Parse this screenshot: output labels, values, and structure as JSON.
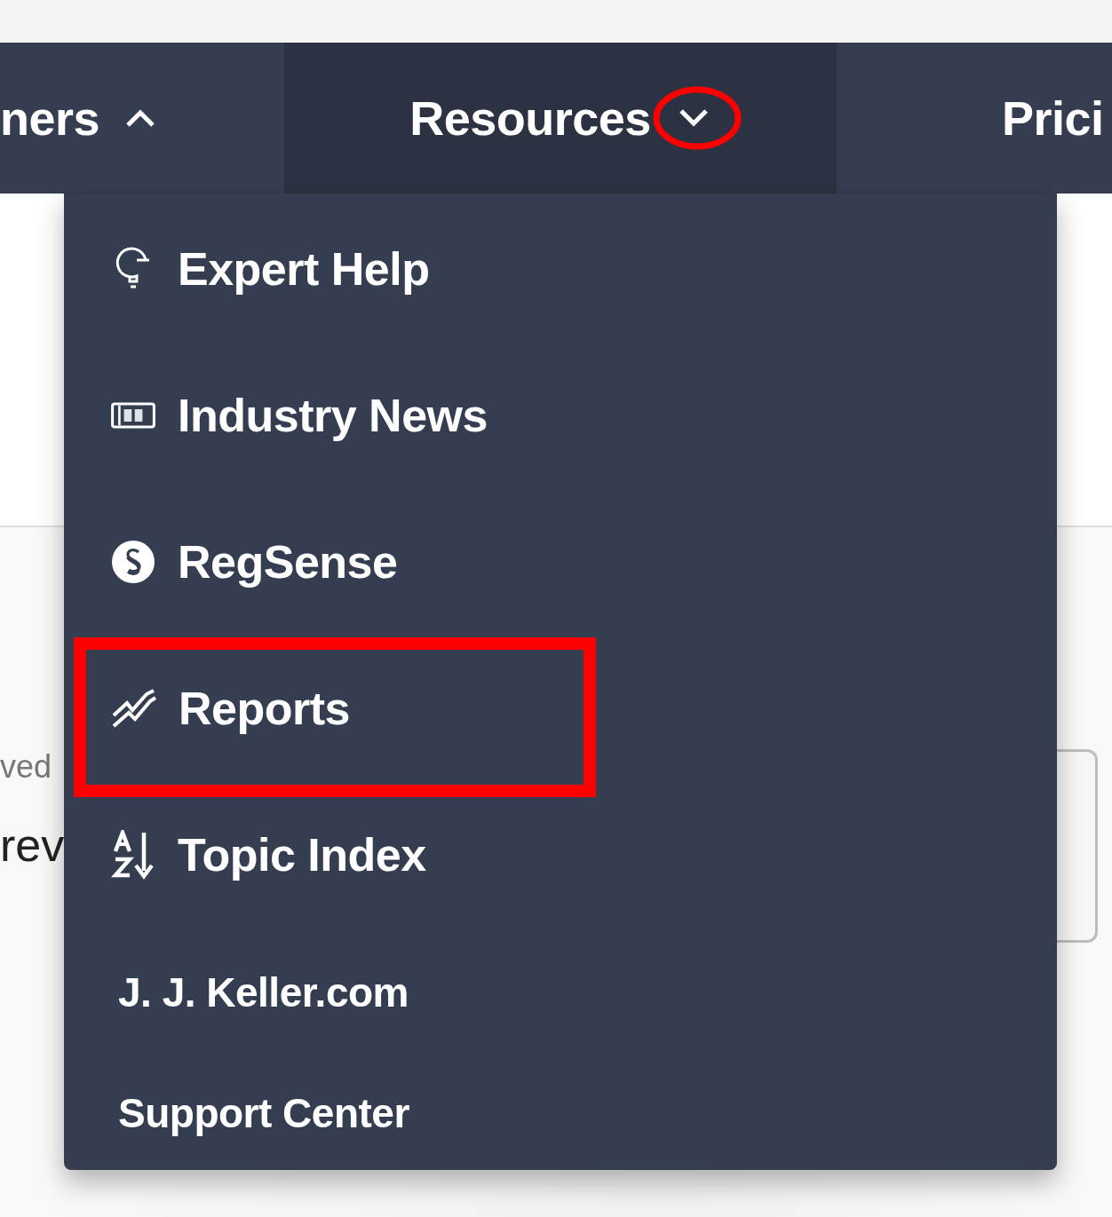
{
  "nav": {
    "tabs": [
      {
        "label": "ners",
        "selected": false,
        "expanded": true
      },
      {
        "label": "Resources",
        "selected": true,
        "expanded": false,
        "annotated": true
      },
      {
        "label": "Prici",
        "selected": false
      }
    ]
  },
  "dropdown": {
    "items": [
      {
        "label": "Expert Help",
        "kind": "feature",
        "highlighted": false
      },
      {
        "label": "Industry News",
        "kind": "feature",
        "highlighted": false
      },
      {
        "label": "RegSense",
        "kind": "feature",
        "highlighted": false
      },
      {
        "label": "Reports",
        "kind": "feature",
        "highlighted": true
      },
      {
        "label": "Topic Index",
        "kind": "feature",
        "highlighted": false
      },
      {
        "label": "J. J. Keller.com",
        "kind": "link",
        "highlighted": false
      },
      {
        "label": "Support Center",
        "kind": "link",
        "highlighted": false
      }
    ]
  },
  "content": {
    "field_label": "ved",
    "text": "rev"
  }
}
